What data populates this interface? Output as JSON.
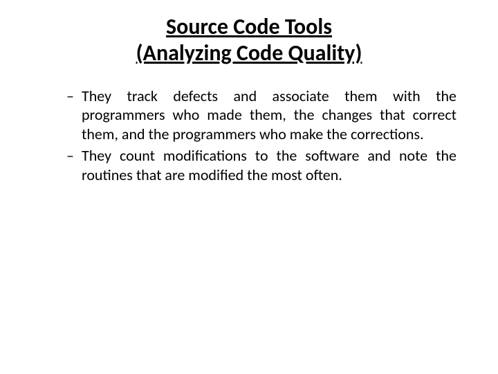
{
  "slide": {
    "title_line1": "Source Code Tools",
    "title_line2": "(Analyzing Code Quality)",
    "bullets": [
      "They track defects and associate them with the programmers who made them, the changes that correct them, and the programmers who make the corrections.",
      "They count modifications to the software and note the routines that are modified the most often."
    ]
  }
}
